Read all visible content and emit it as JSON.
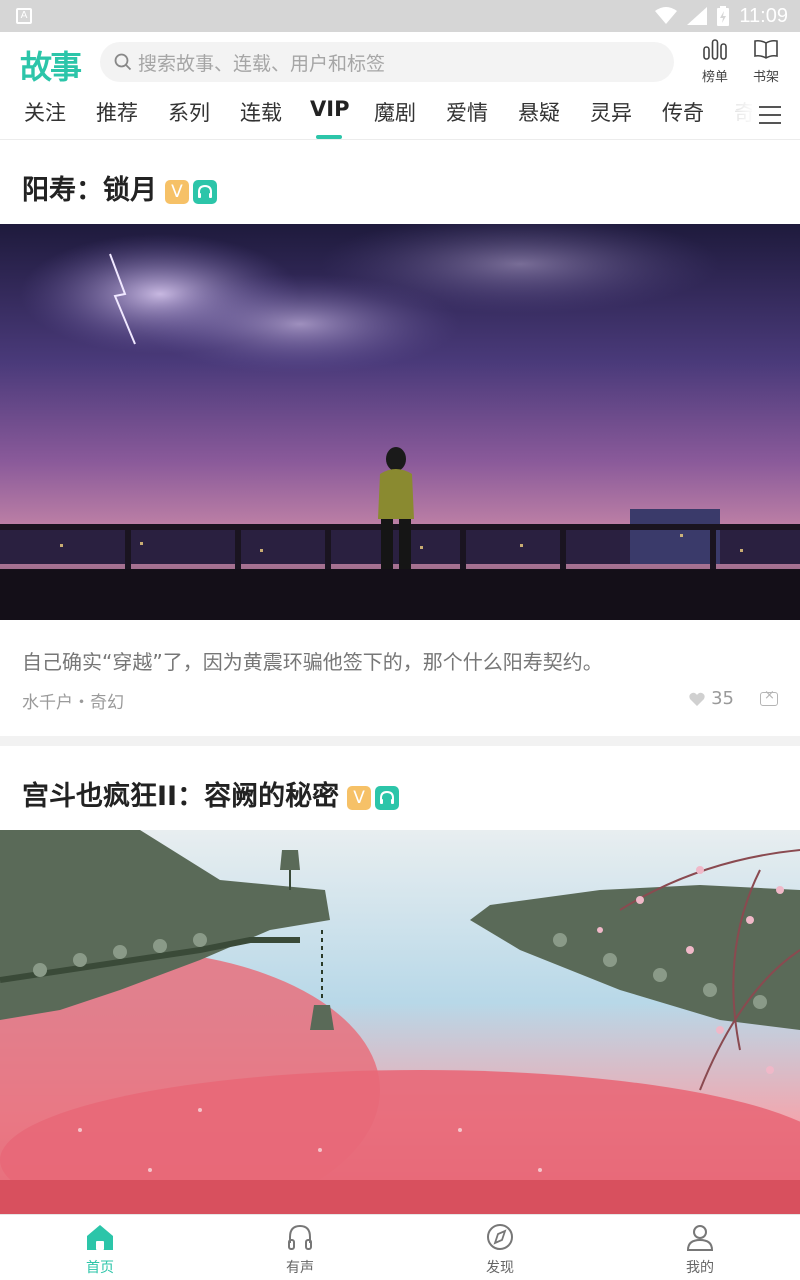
{
  "status": {
    "time": "11:09",
    "left_glyph": "A"
  },
  "app": {
    "logo": "故事"
  },
  "search": {
    "placeholder": "搜索故事、连载、用户和标签"
  },
  "top_actions": [
    {
      "label": "榜单",
      "icon": "chart-bars-icon"
    },
    {
      "label": "书架",
      "icon": "book-open-icon"
    }
  ],
  "tabs": [
    "关注",
    "推荐",
    "系列",
    "连载",
    "VIP",
    "魔剧",
    "爱情",
    "悬疑",
    "灵异",
    "传奇",
    "奇"
  ],
  "active_tab": "VIP",
  "stories": [
    {
      "title": "阳寿：锁月",
      "vip_badge": "V",
      "description": "自己确实“穿越”了，因为黄震环骗他签下的，那个什么阳寿契约。",
      "meta": "水千户・奇幻",
      "likes": "35"
    },
    {
      "title": "宫斗也疯狂II：容阙的秘密",
      "vip_badge": "V"
    }
  ],
  "bottom_nav": [
    {
      "label": "首页",
      "icon": "home-icon",
      "active": true
    },
    {
      "label": "有声",
      "icon": "headphones-icon",
      "active": false
    },
    {
      "label": "发现",
      "icon": "compass-icon",
      "active": false
    },
    {
      "label": "我的",
      "icon": "user-icon",
      "active": false
    }
  ],
  "colors": {
    "accent": "#2cc5a9",
    "vip": "#f6c167"
  }
}
